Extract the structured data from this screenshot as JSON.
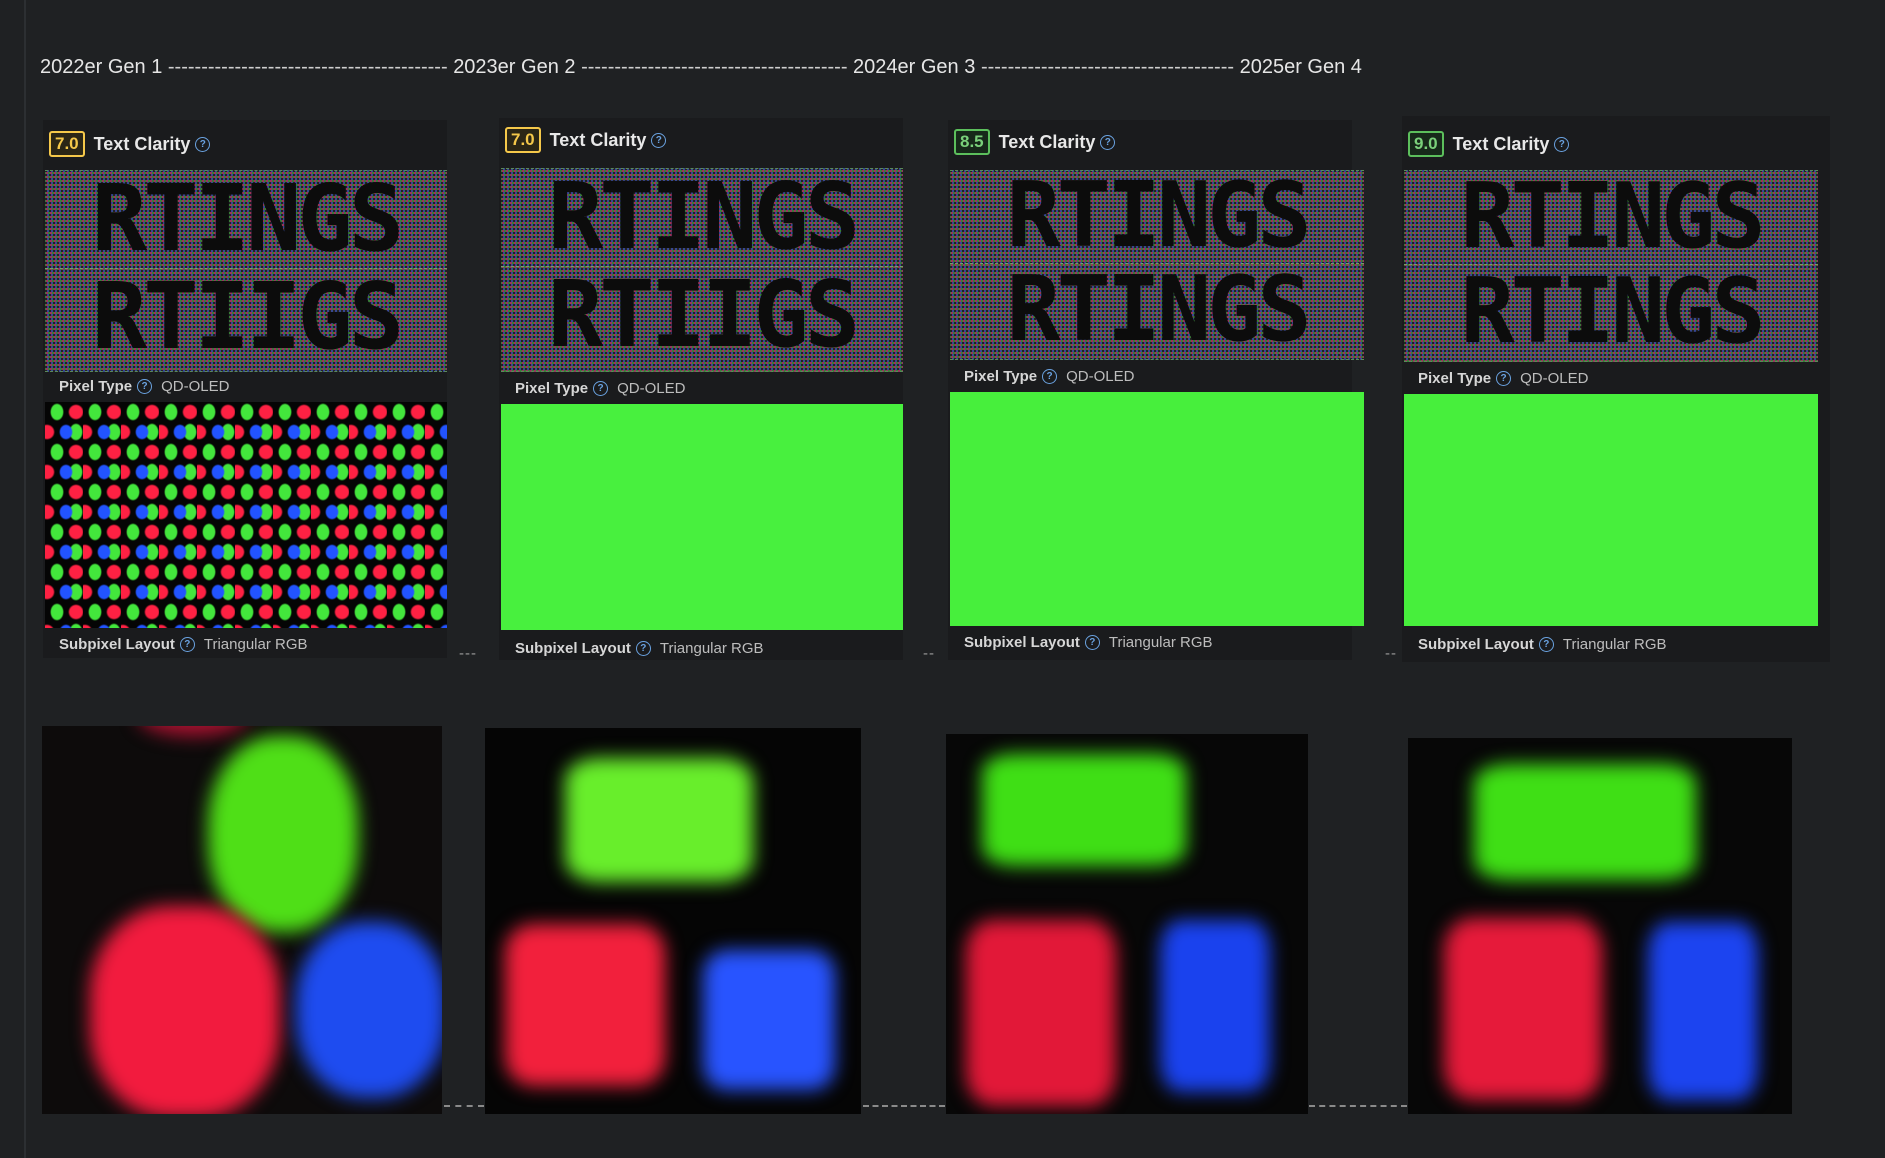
{
  "timeline": {
    "gen1": "2022er Gen 1",
    "gen2": "2023er Gen 2",
    "gen3": "2024er Gen 3",
    "gen4": "2025er Gen 4",
    "dashes1": "------------------------------------------",
    "dashes2": "----------------------------------------",
    "dashes3": "--------------------------------------"
  },
  "labels": {
    "text_clarity": "Text Clarity",
    "pixel_type": "Pixel Type",
    "subpixel_layout": "Subpixel Layout",
    "help_glyph": "?",
    "sample_text": "RTINGS"
  },
  "cards": [
    {
      "score": "7.0",
      "score_color": "#f5c84a",
      "pixel_type": "QD-OLED",
      "subpixel_layout": "Triangular RGB",
      "sample_row2": "RTIIGS"
    },
    {
      "score": "7.0",
      "score_color": "#f5c84a",
      "pixel_type": "QD-OLED",
      "subpixel_layout": "Triangular RGB",
      "sample_row2": "RTIIGS"
    },
    {
      "score": "8.5",
      "score_color": "#7ad07a",
      "pixel_type": "QD-OLED",
      "subpixel_layout": "Triangular RGB",
      "sample_row2": "RTINGS"
    },
    {
      "score": "9.0",
      "score_color": "#7ad07a",
      "pixel_type": "QD-OLED",
      "subpixel_layout": "Triangular RGB",
      "sample_row2": "RTINGS"
    }
  ],
  "connectors": {
    "card_dash_long": "---",
    "card_dash_short": "--"
  },
  "colors": {
    "green": "#46f03c",
    "red": "#ff1f42",
    "blue": "#2c5fff",
    "background": "#1f2123"
  }
}
